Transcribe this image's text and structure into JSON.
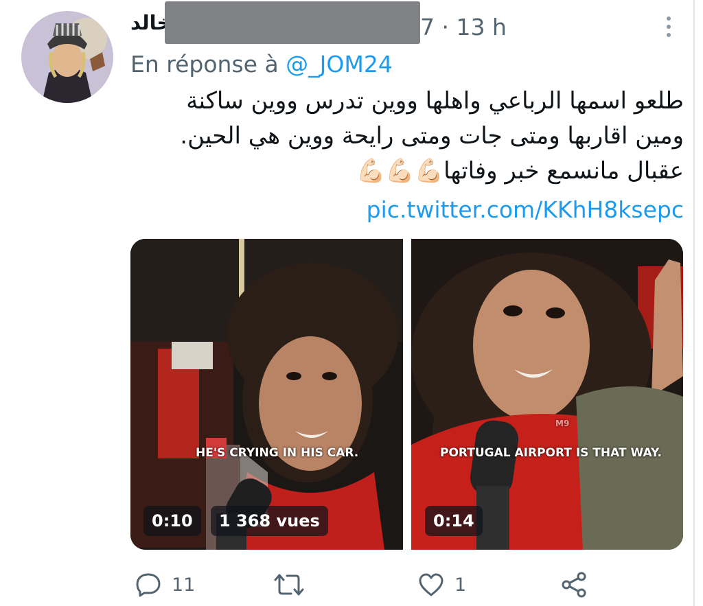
{
  "tweet": {
    "author_name": "خالد",
    "time": "7 · 13 h",
    "reply_prefix": "En réponse à",
    "reply_handle": "@_JOM24",
    "text_lines": [
      "طلعو اسمها الرباعي واهلها ووين تدرس ووين ساكنة",
      "ومين اقاربها ومتى جات ومتى رايحة ووين هي الحين.",
      "عقبال مانسمع خبر وفاتها"
    ],
    "emoji": "💪🏻💪🏻💪🏻",
    "pic_link": "pic.twitter.com/KKhH8ksepc"
  },
  "media": [
    {
      "caption": "HE'S CRYING IN HIS CAR.",
      "duration": "0:10",
      "views": "1 368 vues"
    },
    {
      "caption": "PORTUGAL AIRPORT IS THAT WAY.",
      "duration": "0:14",
      "watermark": "M9"
    }
  ],
  "actions": {
    "replies": "11",
    "retweets": "",
    "likes": "1"
  },
  "icons": [
    "more-icon",
    "reply-icon",
    "retweet-icon",
    "like-icon",
    "share-icon"
  ],
  "colors": {
    "link": "#1d9bf0",
    "secondary": "#536471",
    "text": "#0f1419"
  }
}
